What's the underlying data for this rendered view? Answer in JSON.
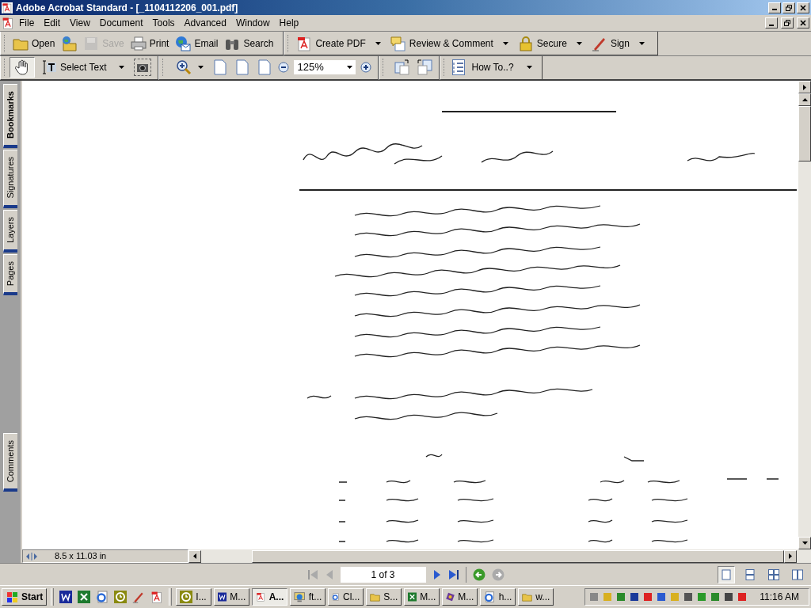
{
  "window": {
    "title": "Adobe Acrobat Standard - [_1104112206_001.pdf]"
  },
  "menu": [
    "File",
    "Edit",
    "View",
    "Document",
    "Tools",
    "Advanced",
    "Window",
    "Help"
  ],
  "toolbar_file": [
    {
      "kind": "labeled",
      "label": "Open",
      "disabled": false
    },
    {
      "kind": "icon",
      "disabled": false
    },
    {
      "kind": "labeled",
      "label": "Save",
      "disabled": true
    },
    {
      "kind": "labeled",
      "label": "Print",
      "disabled": false
    },
    {
      "kind": "labeled",
      "label": "Email",
      "disabled": false
    },
    {
      "kind": "labeled",
      "label": "Search",
      "disabled": false
    }
  ],
  "toolbar_tasks": [
    "Create PDF",
    "Review & Comment",
    "Secure",
    "Sign"
  ],
  "tools": {
    "hand_selected": true,
    "select_label": "Select Text",
    "zoom_value": "125%",
    "howto_label": "How To..?"
  },
  "side_tabs": [
    {
      "label": "Bookmarks",
      "selected": true
    },
    {
      "label": "Signatures",
      "selected": false
    },
    {
      "label": "Layers",
      "selected": false
    },
    {
      "label": "Pages",
      "selected": false
    },
    {
      "label": "Comments",
      "selected": false
    }
  ],
  "status": {
    "page_size": "8.5 x 11.03 in",
    "page_field": "1 of 3"
  },
  "taskbar": {
    "start": "Start",
    "tasks": [
      {
        "label": "I...",
        "selected": false
      },
      {
        "label": "M...",
        "selected": false
      },
      {
        "label": "A...",
        "selected": true
      },
      {
        "label": "ft...",
        "selected": false
      },
      {
        "label": "Cl...",
        "selected": false
      },
      {
        "label": "S...",
        "selected": false
      },
      {
        "label": "M...",
        "selected": false
      },
      {
        "label": "M...",
        "selected": false
      },
      {
        "label": "h...",
        "selected": false
      },
      {
        "label": "w...",
        "selected": false
      }
    ],
    "clock": "11:16 AM"
  }
}
